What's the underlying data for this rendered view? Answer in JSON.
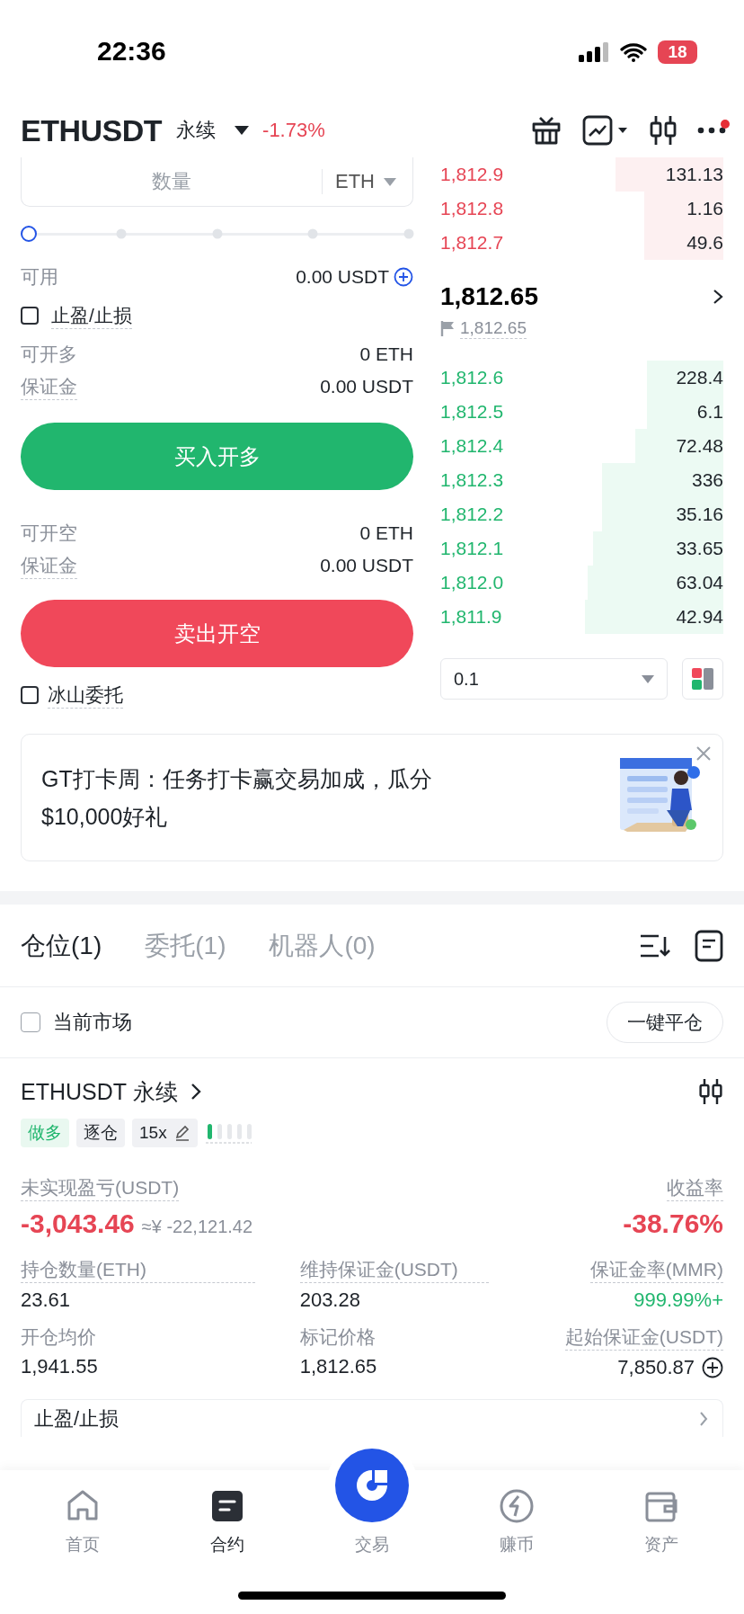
{
  "status_bar": {
    "time": "22:36",
    "battery": "18"
  },
  "header": {
    "symbol": "ETHUSDT",
    "contract_type": "永续",
    "change": "-1.73%"
  },
  "order_form": {
    "quantity_placeholder": "数量",
    "unit": "ETH",
    "slider": {
      "level": 0
    },
    "available": {
      "label": "可用",
      "value": "0.00 USDT"
    },
    "tp_sl": {
      "label": "止盈/止损",
      "checked": false
    },
    "long": {
      "rows": [
        {
          "label": "可开多",
          "value": "0 ETH"
        },
        {
          "label": "保证金",
          "value": "0.00 USDT"
        }
      ],
      "button": "买入开多"
    },
    "short": {
      "rows": [
        {
          "label": "可开空",
          "value": "0 ETH"
        },
        {
          "label": "保证金",
          "value": "0.00 USDT"
        }
      ],
      "button": "卖出开空"
    },
    "iceberg": {
      "label": "冰山委托",
      "checked": false
    }
  },
  "order_book": {
    "asks": [
      {
        "price": "1,812.9",
        "amount": "131.13"
      },
      {
        "price": "1,812.8",
        "amount": "1.16"
      },
      {
        "price": "1,812.7",
        "amount": "49.6"
      }
    ],
    "last_price": "1,812.65",
    "mark_price": "1,812.65",
    "bids": [
      {
        "price": "1,812.6",
        "amount": "228.4"
      },
      {
        "price": "1,812.5",
        "amount": "6.1"
      },
      {
        "price": "1,812.4",
        "amount": "72.48"
      },
      {
        "price": "1,812.3",
        "amount": "336"
      },
      {
        "price": "1,812.2",
        "amount": "35.16"
      },
      {
        "price": "1,812.1",
        "amount": "33.65"
      },
      {
        "price": "1,812.0",
        "amount": "63.04"
      },
      {
        "price": "1,811.9",
        "amount": "42.94"
      }
    ],
    "precision": "0.1"
  },
  "banner": {
    "text": "GT打卡周：任务打卡赢交易加成，瓜分$10,000好礼",
    "kind": "picture"
  },
  "positions": {
    "tabs": [
      {
        "label": "仓位(1)",
        "selected": true
      },
      {
        "label": "委托(1)",
        "selected": false
      },
      {
        "label": "机器人(0)",
        "selected": false
      }
    ],
    "current_market": {
      "label": "当前市场",
      "checked": false
    },
    "close_all": "一键平仓",
    "position": {
      "title": "ETHUSDT 永续",
      "tags": [
        {
          "label": "做多",
          "kind": "side"
        },
        {
          "label": "逐仓",
          "kind": "mode"
        },
        {
          "label": "15x",
          "kind": "leverage"
        }
      ],
      "pnl_label": "未实现盈亏(USDT)",
      "pnl": "-3,043.46",
      "pnl_cny": "≈¥ -22,121.42",
      "roe_label": "收益率",
      "roe": "-38.76%",
      "stats": [
        {
          "label": "持仓数量(ETH)",
          "value": "23.61",
          "kind": "plain",
          "addable": false
        },
        {
          "label": "维持保证金(USDT)",
          "value": "203.28",
          "kind": "plain",
          "addable": false
        },
        {
          "label": "保证金率(MMR)",
          "value": "999.99%+",
          "kind": "positive",
          "addable": false
        },
        {
          "label": "开仓均价",
          "value": "1,941.55",
          "kind": "plain",
          "addable": false
        },
        {
          "label": "标记价格",
          "value": "1,812.65",
          "kind": "plain",
          "addable": false
        },
        {
          "label": "起始保证金(USDT)",
          "value": "7,850.87",
          "kind": "plain",
          "addable": true
        }
      ],
      "tp_sl": "止盈/止损"
    }
  },
  "nav": [
    {
      "label": "首页",
      "kind": "tab",
      "selected": false
    },
    {
      "label": "合约",
      "kind": "tab",
      "selected": true
    },
    {
      "label": "交易",
      "kind": "center",
      "selected": false
    },
    {
      "label": "赚币",
      "kind": "tab",
      "selected": false
    },
    {
      "label": "资产",
      "kind": "tab",
      "selected": false
    }
  ]
}
